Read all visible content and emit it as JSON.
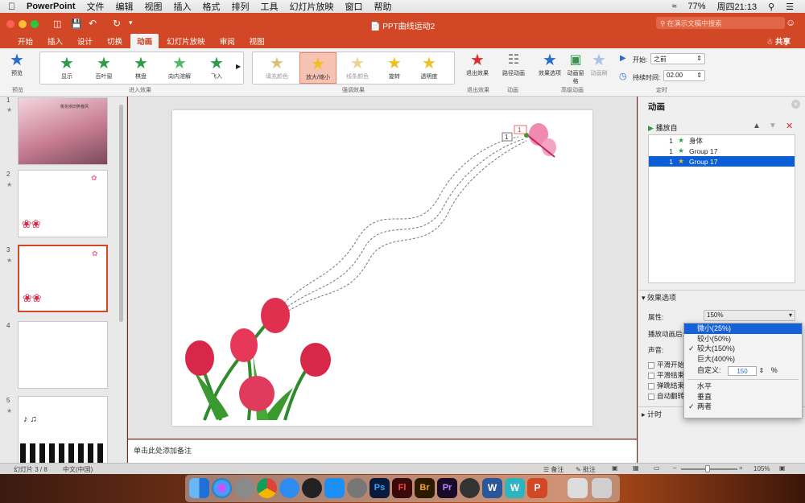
{
  "menubar": {
    "app": "PowerPoint",
    "items": [
      "文件",
      "编辑",
      "视图",
      "插入",
      "格式",
      "排列",
      "工具",
      "幻灯片放映",
      "窗口",
      "帮助"
    ],
    "battery": "77%",
    "clock": "周四21:13"
  },
  "title": {
    "doc": "PPT曲线运动2",
    "search_placeholder": "在演示文稿中搜索",
    "share": "共享"
  },
  "tabs": [
    "开始",
    "插入",
    "设计",
    "切换",
    "动画",
    "幻灯片放映",
    "审阅",
    "视图"
  ],
  "ribbon": {
    "preview": "预览",
    "preview_group": "预览",
    "entry_effects": [
      "显示",
      "百叶窗",
      "棋盘",
      "向内溶解",
      "飞入"
    ],
    "entry_group": "进入效果",
    "emphasis_effects": [
      "填充颜色",
      "放大/缩小",
      "线条颜色",
      "旋转",
      "透明度"
    ],
    "emphasis_group": "强调效果",
    "exit_effect": "退出效果",
    "exit_group": "退出效果",
    "path_anim": "路径动画",
    "anim_group": "动画",
    "effect_options": "效果选项",
    "anim_pane": "动画窗格",
    "anim_painter": "动画刷",
    "adv_group": "高级动画",
    "start_label": "开始:",
    "start_value": "之前",
    "duration_label": "持续时间:",
    "duration_value": "02.00",
    "timing_group": "定时"
  },
  "slides": [
    {
      "num": "1"
    },
    {
      "num": "2"
    },
    {
      "num": "3"
    },
    {
      "num": "4"
    },
    {
      "num": "5"
    }
  ],
  "slide1_text": "桃花依旧笑春风",
  "notes_placeholder": "单击此处添加备注",
  "anim_pane": {
    "title": "动画",
    "play_from": "播放自",
    "items": [
      {
        "num": "1",
        "name": "身体"
      },
      {
        "num": "1",
        "name": "Group 17"
      },
      {
        "num": "1",
        "name": "Group 17"
      }
    ]
  },
  "effect_options": {
    "title": "效果选项",
    "property_label": "属性:",
    "property_value": "150%",
    "after_label": "播放动画后:",
    "sound_label": "声音:",
    "checkboxes": [
      "平滑开始",
      "平滑结束",
      "弹跳结束",
      "自动翻转"
    ],
    "timing_title": "计时"
  },
  "dropdown": {
    "options": [
      "微小(25%)",
      "较小(50%)",
      "较大(150%)",
      "巨大(400%)"
    ],
    "checked_index": 2,
    "custom_label": "自定义:",
    "custom_value": "150",
    "custom_unit": "%",
    "directions": [
      "水平",
      "垂直",
      "两者"
    ]
  },
  "path_labels": [
    "1",
    "1"
  ],
  "status": {
    "slide": "幻灯片 3 / 8",
    "lang": "中文(中国)",
    "notes": "备注",
    "comments": "批注",
    "zoom": "105%"
  },
  "colors": {
    "accent": "#d24726",
    "selection": "#0a5fd6"
  }
}
